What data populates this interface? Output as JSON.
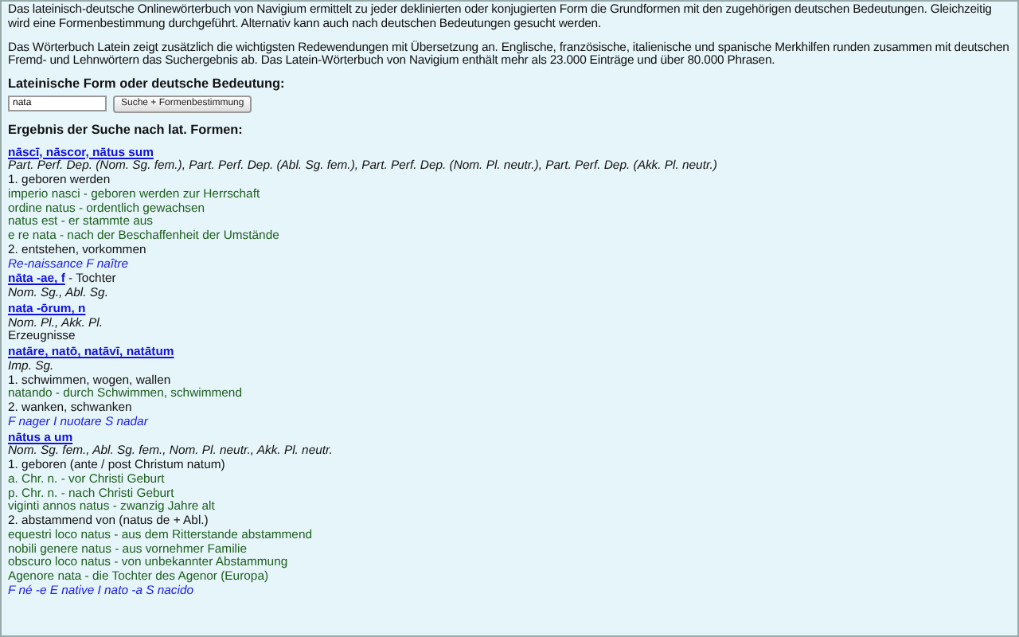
{
  "intro": [
    "Das lateinisch-deutsche Onlinewörterbuch von Navigium ermittelt zu jeder deklinierten oder konjugierten Form die Grundformen mit den zugehörigen deutschen Bedeutungen. Gleichzeitig wird eine Formenbestimmung durchgeführt. Alternativ kann auch nach deutschen Bedeutungen gesucht werden.",
    "Das Wörterbuch Latein zeigt zusätzlich die wichtigsten Redewendungen mit Übersetzung an. Englische, französische, italienische und spanische Merkhilfen runden zusammen mit deutschen Fremd- und Lehnwörtern das Suchergebnis ab. Das Latein-Wörterbuch von Navigium enthält mehr als 23.000 Einträge und über 80.000 Phrasen."
  ],
  "search": {
    "label": "Lateinische Form oder deutsche Bedeutung:",
    "value": "nata",
    "button": "Suche + Formenbestimmung"
  },
  "results_heading": "Ergebnis der Suche nach lat. Formen:",
  "entries": [
    {
      "headword": "nāscī, nāscor, nātus sum",
      "lines": [
        {
          "kind": "forms",
          "text": "Part. Perf. Dep. (Nom. Sg. fem.), Part. Perf. Dep. (Abl. Sg. fem.), Part. Perf. Dep. (Nom. Pl. neutr.), Part. Perf. Dep. (Akk. Pl. neutr.)"
        },
        {
          "kind": "meaning",
          "text": "1. geboren werden"
        },
        {
          "kind": "phrase",
          "text": "imperio nasci - geboren werden zur Herrschaft"
        },
        {
          "kind": "phrase",
          "text": "ordine natus - ordentlich gewachsen"
        },
        {
          "kind": "phrase",
          "text": "natus est - er stammte aus"
        },
        {
          "kind": "phrase",
          "text": "e re nata - nach der Beschaffenheit der Umstände"
        },
        {
          "kind": "meaning",
          "text": "2. entstehen, vorkommen"
        },
        {
          "kind": "hint",
          "text": "Re-naissance F naître"
        }
      ]
    },
    {
      "headword": "nāta -ae, f",
      "gloss": "- Tochter",
      "lines": [
        {
          "kind": "forms",
          "text": "Nom. Sg., Abl. Sg."
        }
      ]
    },
    {
      "headword": "nata -ōrum, n",
      "lines": [
        {
          "kind": "forms",
          "text": "Nom. Pl., Akk. Pl."
        },
        {
          "kind": "meaning",
          "text": "Erzeugnisse"
        }
      ]
    },
    {
      "headword": "natāre, natō, natāvī, natātum",
      "lines": [
        {
          "kind": "forms",
          "text": "Imp. Sg."
        },
        {
          "kind": "meaning",
          "text": "1. schwimmen, wogen, wallen"
        },
        {
          "kind": "phrase",
          "text": "natando - durch Schwimmen, schwimmend"
        },
        {
          "kind": "meaning",
          "text": "2. wanken, schwanken"
        },
        {
          "kind": "hint",
          "text": "F nager I nuotare S nadar"
        }
      ]
    },
    {
      "headword": "nātus a um",
      "lines": [
        {
          "kind": "forms",
          "text": "Nom. Sg. fem., Abl. Sg. fem., Nom. Pl. neutr., Akk. Pl. neutr."
        },
        {
          "kind": "meaning",
          "text": "1. geboren (ante / post Christum natum)"
        },
        {
          "kind": "phrase",
          "text": "a. Chr. n. - vor Christi Geburt"
        },
        {
          "kind": "phrase",
          "text": "p. Chr. n. - nach Christi Geburt"
        },
        {
          "kind": "phrase",
          "text": "viginti annos natus - zwanzig Jahre alt"
        },
        {
          "kind": "meaning",
          "text": "2. abstammend von (natus de + Abl.)"
        },
        {
          "kind": "phrase",
          "text": "equestri loco natus - aus dem Ritterstande abstammend"
        },
        {
          "kind": "phrase",
          "text": "nobili genere natus - aus vornehmer Familie"
        },
        {
          "kind": "phrase",
          "text": "obscuro loco natus - von unbekannter Abstammung"
        },
        {
          "kind": "phrase",
          "text": "Agenore nata - die Tochter des Agenor (Europa)"
        },
        {
          "kind": "hint",
          "text": "F né -e E native I nato -a S nacido"
        }
      ]
    }
  ]
}
